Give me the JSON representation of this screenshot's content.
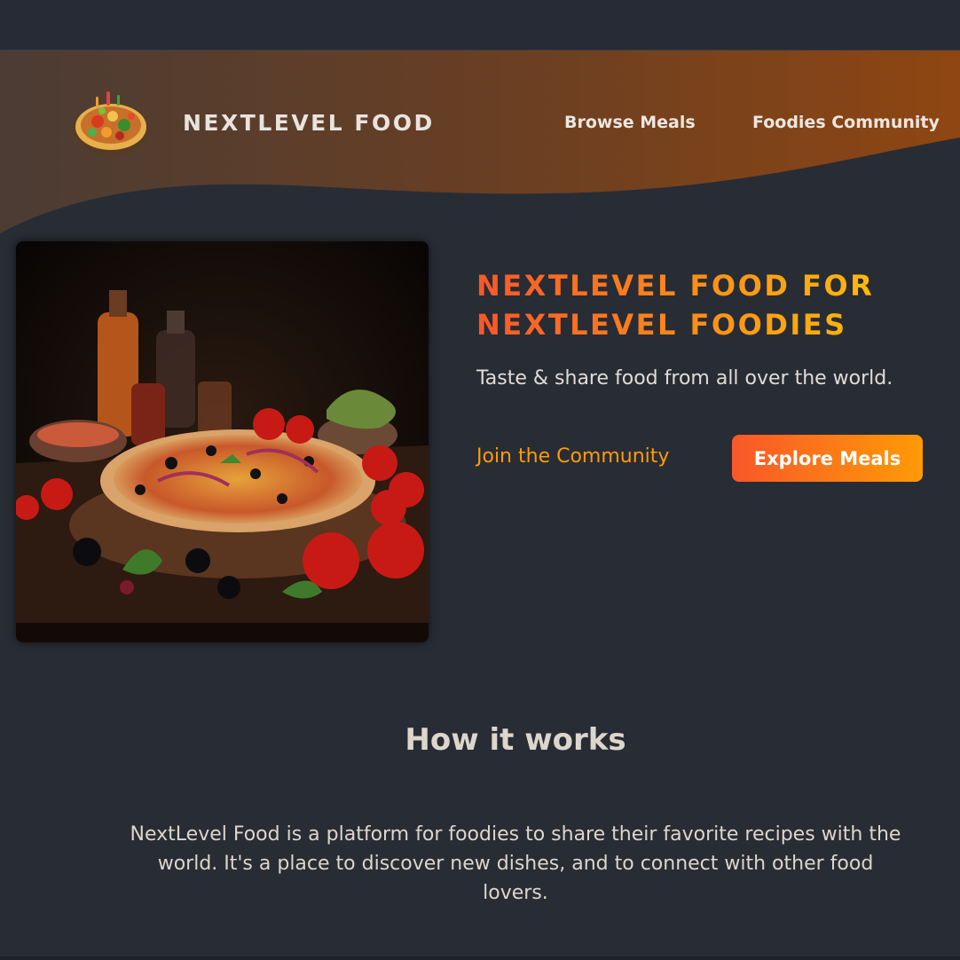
{
  "header": {
    "logo_text": "NEXTLEVEL FOOD",
    "nav": {
      "browse_meals": "Browse Meals",
      "foodies_community": "Foodies Community"
    },
    "gradient": [
      "#4a3b32",
      "#8b4513"
    ]
  },
  "hero": {
    "title": "NEXTLEVEL FOOD FOR NEXTLEVEL FOODIES",
    "subtitle": "Taste & share food from all over the world.",
    "join_link": "Join the Community",
    "explore_button": "Explore Meals",
    "image_icon": "pizza-image"
  },
  "how_it_works": {
    "title": "How it works",
    "body": "NextLevel Food is a platform for foodies to share their favorite recipes with the world. It's a place to discover new dishes, and to connect with other food lovers."
  },
  "colors": {
    "background": "#282c35",
    "accent_start": "#f9572a",
    "accent_end": "#ffc905",
    "link": "#ff9b05",
    "text": "#ddd6cb"
  }
}
